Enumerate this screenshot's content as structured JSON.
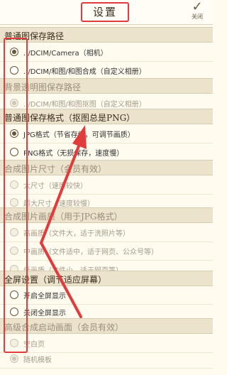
{
  "header": {
    "title": "设置",
    "close_label": "关闭",
    "close_icon": "checkmark-icon"
  },
  "sections": [
    {
      "title": "普通图保存路径",
      "dim": false
    },
    {
      "title": "背景透明图保存路径",
      "dim": true
    },
    {
      "title": "普通图保存格式（抠图总是PNG）",
      "dim": false
    },
    {
      "title": "合成图片尺寸（会员有效）",
      "dim": true
    },
    {
      "title": "合成图片画质（用于JPG格式）",
      "dim": true
    },
    {
      "title": "全屏设置（调节适应屏幕）",
      "dim": false
    },
    {
      "title": "高级合成启动画面（会员有效）",
      "dim": true
    }
  ],
  "options": {
    "normal_path": [
      {
        "label": "../DCIM/Camera（相机）",
        "checked": true,
        "disabled": false
      },
      {
        "label": "../DCIM/和图/和图合成（自定义相册）",
        "checked": false,
        "disabled": false
      }
    ],
    "transparent_path": [
      {
        "label": "../DCIM/和图/和图抠图（自定义相册）",
        "checked": true,
        "disabled": true
      }
    ],
    "format": [
      {
        "label": "JPG格式（节省存储，可调节画质）",
        "checked": true,
        "disabled": false
      },
      {
        "label": "PNG格式（无损保存，速度慢）",
        "checked": false,
        "disabled": false
      }
    ],
    "size": [
      {
        "label": "大尺寸（速度较快）",
        "checked": false,
        "disabled": true
      },
      {
        "label": "超大尺寸（速度较慢）",
        "checked": false,
        "disabled": true
      }
    ],
    "quality": [
      {
        "label": "高画质（文件大，适于洗照片等）",
        "checked": false,
        "disabled": true
      },
      {
        "label": "中画质（文件适中，适于网页、公众号等）",
        "checked": false,
        "disabled": true
      },
      {
        "label": "低画质（文件小，适于网页等）",
        "checked": false,
        "disabled": true
      }
    ],
    "fullscreen": [
      {
        "label": "开启全屏显示",
        "checked": false,
        "disabled": false
      },
      {
        "label": "关闭全屏显示",
        "checked": false,
        "disabled": false
      }
    ],
    "splash": [
      {
        "label": "空白页",
        "checked": false,
        "disabled": true
      },
      {
        "label": "随机模板",
        "checked": true,
        "disabled": true
      }
    ]
  },
  "colors": {
    "highlight": "#e23b3b",
    "background": "#fffbef",
    "section_bg": "#ece3cc"
  }
}
